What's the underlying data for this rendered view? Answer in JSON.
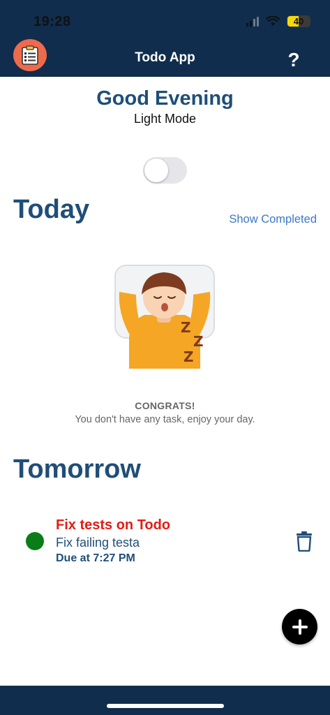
{
  "status_bar": {
    "time": "19:28",
    "battery_level": "40"
  },
  "header": {
    "title": "Todo App",
    "help_label": "?"
  },
  "greeting": {
    "title": "Good Evening",
    "mode_label": "Light Mode",
    "dark_mode_on": false
  },
  "today": {
    "title": "Today",
    "show_completed_label": "Show Completed",
    "empty_title": "CONGRATS!",
    "empty_message": "You don't have any task, enjoy your day."
  },
  "tomorrow": {
    "title": "Tomorrow",
    "tasks": [
      {
        "title": "Fix tests on Todo",
        "description": "Fix failing testa",
        "due": "Due at 7:27 PM",
        "status_color": "#0b7d18"
      }
    ]
  },
  "colors": {
    "header_bg": "#102d4d",
    "accent": "#1f4e78",
    "link": "#3a78c9",
    "danger": "#e31b14",
    "logo_bg": "#ef6a4c"
  },
  "icons": {
    "logo": "clipboard-icon",
    "help": "question-icon",
    "delete": "trash-icon",
    "add": "plus-icon"
  }
}
